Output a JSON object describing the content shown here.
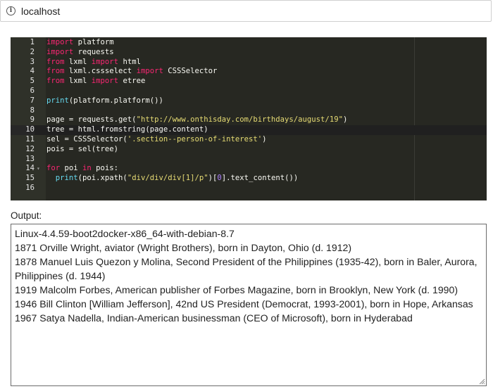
{
  "browser": {
    "url": "localhost"
  },
  "code": {
    "lines": [
      {
        "n": "1",
        "tokens": [
          {
            "t": "import",
            "c": "kw"
          },
          {
            "t": " platform",
            "c": ""
          }
        ]
      },
      {
        "n": "2",
        "tokens": [
          {
            "t": "import",
            "c": "kw"
          },
          {
            "t": " requests",
            "c": ""
          }
        ]
      },
      {
        "n": "3",
        "tokens": [
          {
            "t": "from",
            "c": "kw"
          },
          {
            "t": " lxml ",
            "c": ""
          },
          {
            "t": "import",
            "c": "kw"
          },
          {
            "t": " html",
            "c": ""
          }
        ]
      },
      {
        "n": "4",
        "tokens": [
          {
            "t": "from",
            "c": "kw"
          },
          {
            "t": " lxml.cssselect ",
            "c": ""
          },
          {
            "t": "import",
            "c": "kw"
          },
          {
            "t": " CSSSelector",
            "c": ""
          }
        ]
      },
      {
        "n": "5",
        "tokens": [
          {
            "t": "from",
            "c": "kw"
          },
          {
            "t": " lxml ",
            "c": ""
          },
          {
            "t": "import",
            "c": "kw"
          },
          {
            "t": " etree",
            "c": ""
          }
        ]
      },
      {
        "n": "6",
        "tokens": []
      },
      {
        "n": "7",
        "tokens": [
          {
            "t": "print",
            "c": "fn"
          },
          {
            "t": "(platform.platform())",
            "c": ""
          }
        ]
      },
      {
        "n": "8",
        "tokens": []
      },
      {
        "n": "9",
        "tokens": [
          {
            "t": "page = requests.get(",
            "c": ""
          },
          {
            "t": "\"http://www.onthisday.com/birthdays/august/19\"",
            "c": "str"
          },
          {
            "t": ")",
            "c": ""
          }
        ]
      },
      {
        "n": "10",
        "active": true,
        "tokens": [
          {
            "t": "tree = html.fromstring(page.content)",
            "c": ""
          }
        ]
      },
      {
        "n": "11",
        "tokens": [
          {
            "t": "sel = CSSSelector(",
            "c": ""
          },
          {
            "t": "'.section--person-of-interest'",
            "c": "str"
          },
          {
            "t": ")",
            "c": ""
          }
        ]
      },
      {
        "n": "12",
        "tokens": [
          {
            "t": "pois = sel(tree)",
            "c": ""
          }
        ]
      },
      {
        "n": "13",
        "tokens": []
      },
      {
        "n": "14",
        "fold": true,
        "tokens": [
          {
            "t": "for",
            "c": "kw"
          },
          {
            "t": " poi ",
            "c": ""
          },
          {
            "t": "in",
            "c": "kw"
          },
          {
            "t": " pois:",
            "c": ""
          }
        ]
      },
      {
        "n": "15",
        "tokens": [
          {
            "t": "  ",
            "c": ""
          },
          {
            "t": "print",
            "c": "fn"
          },
          {
            "t": "(poi.xpath(",
            "c": ""
          },
          {
            "t": "\"div/div/div[1]/p\"",
            "c": "str"
          },
          {
            "t": ")[",
            "c": ""
          },
          {
            "t": "0",
            "c": "num"
          },
          {
            "t": "].text_content())",
            "c": ""
          }
        ]
      },
      {
        "n": "16",
        "tokens": []
      }
    ]
  },
  "output": {
    "label": "Output:",
    "lines": [
      "Linux-4.4.59-boot2docker-x86_64-with-debian-8.7",
      "1871 Orville Wright, aviator (Wright Brothers), born in Dayton, Ohio (d. 1912)",
      "1878 Manuel Luis Quezon y Molina, Second President of the Philippines (1935-42), born in Baler, Aurora,",
      "Philippines (d. 1944)",
      "1919 Malcolm Forbes, American publisher of Forbes Magazine, born in Brooklyn, New York (d. 1990)",
      "1946 Bill Clinton [William Jefferson], 42nd US President (Democrat, 1993-2001), born in Hope, Arkansas",
      "1967 Satya Nadella, Indian-American businessman (CEO of Microsoft), born in Hyderabad"
    ]
  },
  "colors": {
    "editor_bg": "#272822",
    "keyword": "#f92672",
    "builtin": "#66d9ef",
    "string": "#e6db74",
    "number": "#ae81ff"
  }
}
